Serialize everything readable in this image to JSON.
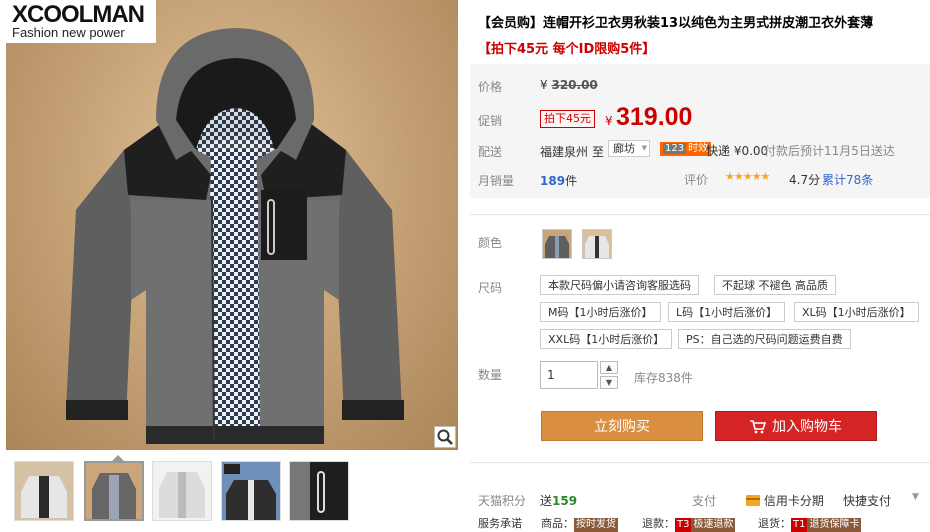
{
  "brand": {
    "name": "XCOOLMAN",
    "tagline": "Fashion new power"
  },
  "product": {
    "title": "【会员购】连帽开衫卫衣男秋装13以纯色为主男式拼皮潮卫衣外套薄",
    "subtitle": "【拍下45元 每个ID限购5件】"
  },
  "price": {
    "label": "价格",
    "currency": "¥",
    "original": "320.00"
  },
  "promo": {
    "label": "促销",
    "tag": "拍下45元",
    "currency": "¥",
    "price": "319.00"
  },
  "shipping": {
    "label": "配送",
    "from": "福建泉州",
    "to_word": "至",
    "to_city": "廊坊",
    "badge_num": "123",
    "badge_text": "时效",
    "express": "快递 ¥0.00",
    "eta": "付款后预计11月5日送达"
  },
  "sales": {
    "label": "月销量",
    "count": "189",
    "unit": "件",
    "rating_label": "评价",
    "stars": "★★★★★",
    "rating": "4.7分",
    "reviews": "累计78条"
  },
  "color": {
    "label": "颜色",
    "swatch_icons": [
      "gray-jacket-swatch-icon",
      "white-jacket-swatch-icon"
    ]
  },
  "size": {
    "label": "尺码",
    "options": [
      "本款尺码偏小请咨询客服选码",
      "不起球 不褪色 高品质",
      "M码【1小时后涨价】",
      "L码【1小时后涨价】",
      "XL码【1小时后涨价】",
      "XXL码【1小时后涨价】",
      "PS：自己选的尺码问题运费自费"
    ]
  },
  "quantity": {
    "label": "数量",
    "value": "1",
    "stock": "库存838件"
  },
  "buttons": {
    "buy": "立刻购买",
    "cart": "加入购物车"
  },
  "footer": {
    "points_label": "天猫积分",
    "points_prefix": "送",
    "points_value": "159",
    "pay_label": "支付",
    "credit": "信用卡分期",
    "quick_pay": "快捷支付",
    "promise_label": "服务承诺",
    "promise_1_prefix": "商品：",
    "promise_1_tag": "按时发货",
    "promise_2_prefix": "退款：",
    "promise_2_badge": "T3",
    "promise_2_tag": "极速退款",
    "promise_3_prefix": "退货：",
    "promise_3_badge": "T1",
    "promise_3_tag": "退货保障卡"
  },
  "colors": {
    "accent_red": "#cc0000",
    "buy_orange": "#d98f3f",
    "cart_red": "#d42424",
    "star": "#f5a623"
  },
  "icons": [
    "zoom-icon",
    "cart-icon",
    "credit-card-icon",
    "chevron-down-icon",
    "stepper-up-icon",
    "stepper-down-icon"
  ]
}
